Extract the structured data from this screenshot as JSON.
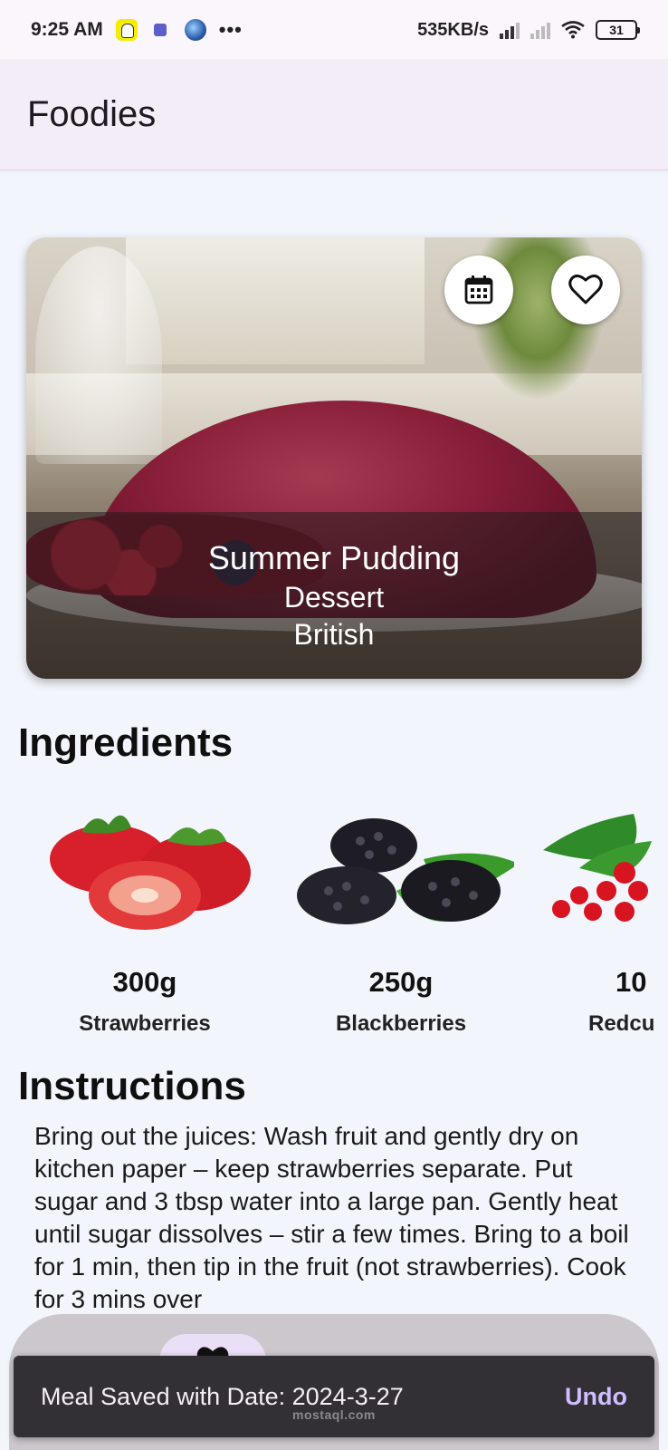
{
  "status_bar": {
    "time": "9:25 AM",
    "dots": "•••",
    "speed": "535KB/s",
    "battery": "31",
    "icons": [
      "snapchat-icon",
      "teams-icon",
      "globe-icon",
      "signal-icon",
      "signal-off-icon",
      "wifi-icon",
      "battery-icon"
    ]
  },
  "app_bar": {
    "title": "Foodies"
  },
  "meal": {
    "name": "Summer Pudding",
    "category": "Dessert",
    "area": "British",
    "actions": [
      "calendar-icon",
      "heart-icon"
    ]
  },
  "ingredients": {
    "title": "Ingredients",
    "items": [
      {
        "qty": "300g",
        "name": "Strawberries"
      },
      {
        "qty": "250g",
        "name": "Blackberries"
      },
      {
        "qty": "10",
        "name": "Redcu"
      }
    ]
  },
  "instructions": {
    "title": "Instructions",
    "text": "Bring out the juices: Wash fruit and gently dry on kitchen paper – keep strawberries separate. Put sugar and 3 tbsp water into a large pan. Gently heat until sugar dissolves – stir a few times. Bring to a boil for 1 min, then tip in the fruit (not strawberries). Cook for 3 mins over"
  },
  "snackbar": {
    "message": "Meal Saved with Date: 2024-3-27",
    "action": "Undo"
  },
  "watermark": "mostaql.com",
  "colors": {
    "app_bar_bg": "#f2edf6",
    "page_bg": "#f3f5fc",
    "snackbar_bg": "#322f35",
    "snackbar_action": "#d0bcff",
    "nav_pill": "#ebdff7"
  }
}
